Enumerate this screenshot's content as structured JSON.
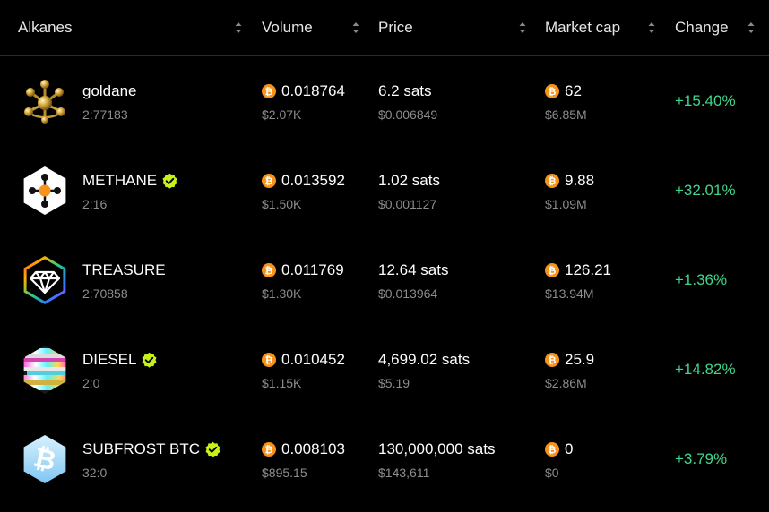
{
  "header": {
    "columns": [
      {
        "label": "Alkanes"
      },
      {
        "label": "Volume"
      },
      {
        "label": "Price"
      },
      {
        "label": "Market cap"
      },
      {
        "label": "Change"
      }
    ]
  },
  "colors": {
    "positive": "#3fd58b",
    "verified": "#c6f21a",
    "btc": "#f7931a",
    "muted": "#8d8d8d"
  },
  "rows": [
    {
      "name": "goldane",
      "id": "2:77183",
      "verified": false,
      "logo_icon": "gold-molecule-icon",
      "volume_btc": "0.018764",
      "volume_usd": "$2.07K",
      "price_sats": "6.2 sats",
      "price_usd": "$0.006849",
      "mcap_btc": "62",
      "mcap_usd": "$6.85M",
      "change": "+15.40%"
    },
    {
      "name": "METHANE",
      "id": "2:16",
      "verified": true,
      "logo_icon": "methane-molecule-icon",
      "volume_btc": "0.013592",
      "volume_usd": "$1.50K",
      "price_sats": "1.02 sats",
      "price_usd": "$0.001127",
      "mcap_btc": "9.88",
      "mcap_usd": "$1.09M",
      "change": "+32.01%"
    },
    {
      "name": "TREASURE",
      "id": "2:70858",
      "verified": false,
      "logo_icon": "diamond-icon",
      "volume_btc": "0.011769",
      "volume_usd": "$1.30K",
      "price_sats": "12.64 sats",
      "price_usd": "$0.013964",
      "mcap_btc": "126.21",
      "mcap_usd": "$13.94M",
      "change": "+1.36%"
    },
    {
      "name": "DIESEL",
      "id": "2:0",
      "verified": true,
      "logo_icon": "glitch-hexagon-icon",
      "volume_btc": "0.010452",
      "volume_usd": "$1.15K",
      "price_sats": "4,699.02 sats",
      "price_usd": "$5.19",
      "mcap_btc": "25.9",
      "mcap_usd": "$2.86M",
      "change": "+14.82%"
    },
    {
      "name": "SUBFROST BTC",
      "id": "32:0",
      "verified": true,
      "logo_icon": "frost-bitcoin-icon",
      "volume_btc": "0.008103",
      "volume_usd": "$895.15",
      "price_sats": "130,000,000 sats",
      "price_usd": "$143,611",
      "mcap_btc": "0",
      "mcap_usd": "$0",
      "change": "+3.79%"
    }
  ]
}
